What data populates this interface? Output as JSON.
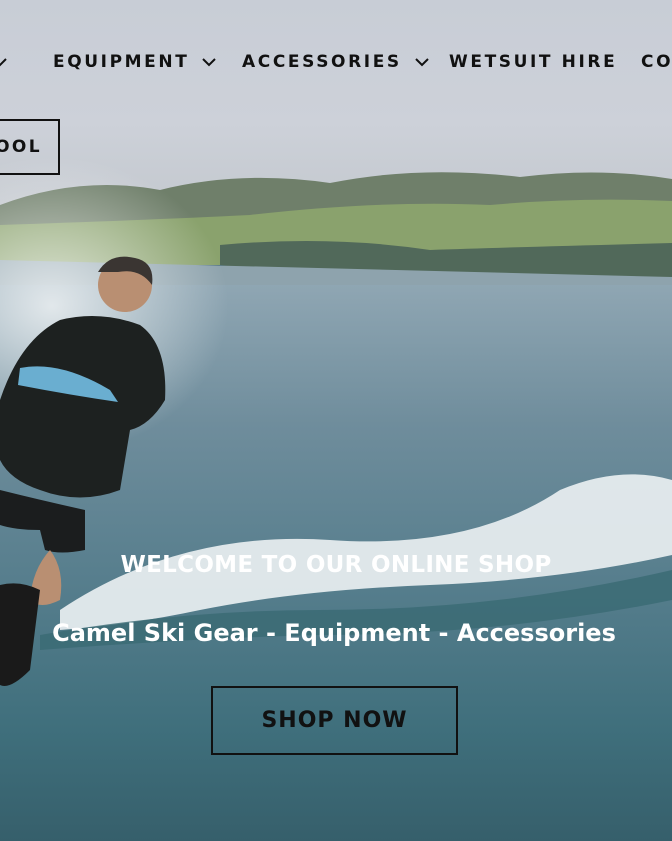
{
  "nav": {
    "items": [
      {
        "label": "",
        "has_dropdown": true
      },
      {
        "label": "EQUIPMENT",
        "has_dropdown": true
      },
      {
        "label": "ACCESSORIES",
        "has_dropdown": true
      },
      {
        "label": "WETSUIT HIRE",
        "has_dropdown": false
      },
      {
        "label": "CO",
        "has_dropdown": false
      }
    ]
  },
  "school_button": {
    "label": "OOL"
  },
  "hero": {
    "welcome": "WELCOME TO OUR ONLINE SHOP",
    "subtitle": "Camel Ski Gear - Equipment - Accessories",
    "cta_label": "SHOP NOW"
  },
  "colors": {
    "text_dark": "#111111",
    "text_light": "#ffffff",
    "sea": "#557d8c",
    "sky": "#cdd1d9"
  },
  "icons": {
    "dropdown": "chevron-down-icon"
  }
}
